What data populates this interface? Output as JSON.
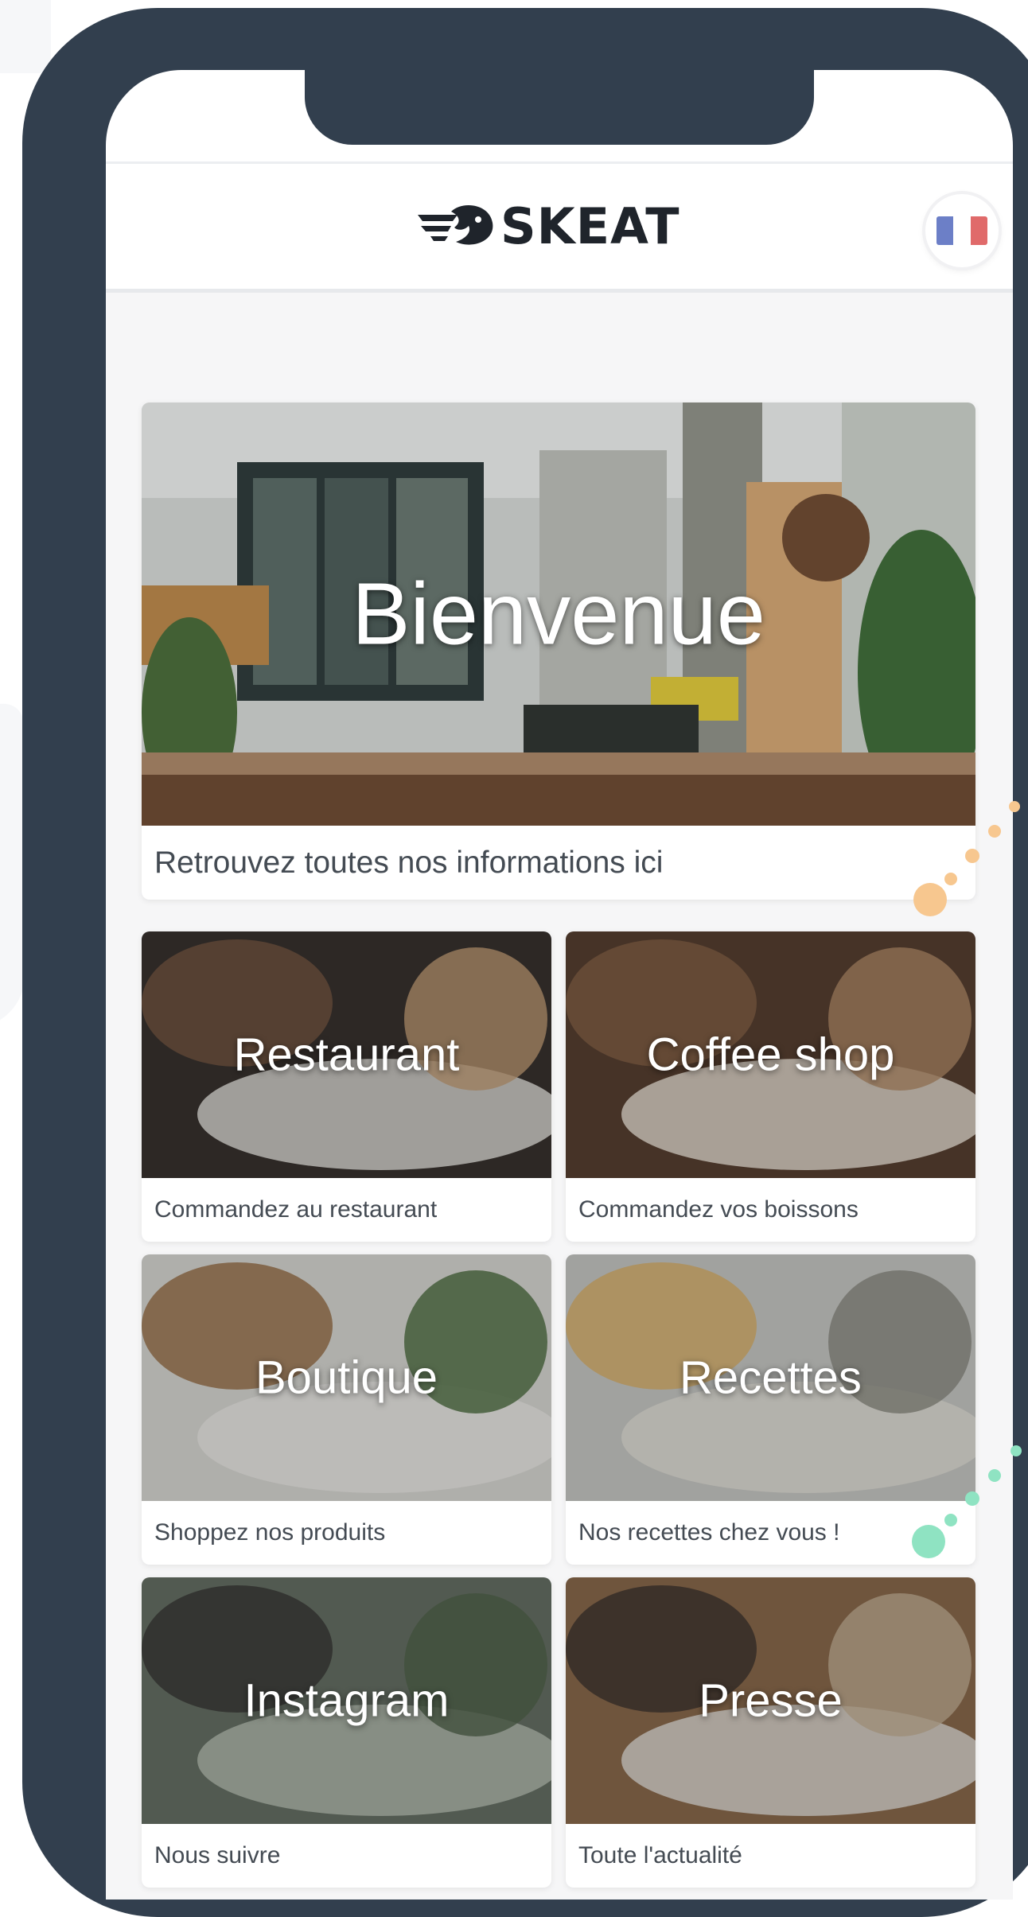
{
  "app": {
    "brand": "SKEAT",
    "language_flag": "FR"
  },
  "colors": {
    "frame": "#323f4e",
    "accent_orange": "#f7c78f",
    "accent_green": "#8fe3c2",
    "flag_blue": "#6c7fc7",
    "flag_red": "#e06a6a"
  },
  "hero": {
    "title": "Bienvenue",
    "subtitle": "Retrouvez toutes nos informations ici"
  },
  "tiles": [
    {
      "title": "Restaurant",
      "subtitle": "Commandez au restaurant",
      "icon": "restaurant-photo"
    },
    {
      "title": "Coffee shop",
      "subtitle": "Commandez vos boissons",
      "icon": "coffee-photo"
    },
    {
      "title": "Boutique",
      "subtitle": "Shoppez nos produits",
      "icon": "shop-photo"
    },
    {
      "title": "Recettes",
      "subtitle": "Nos recettes chez vous !",
      "icon": "pancake-photo"
    },
    {
      "title": "Instagram",
      "subtitle": "Nous suivre",
      "icon": "cafe-terrace-photo"
    },
    {
      "title": "Presse",
      "subtitle": "Toute l'actualité",
      "icon": "newspaper-photo"
    }
  ]
}
